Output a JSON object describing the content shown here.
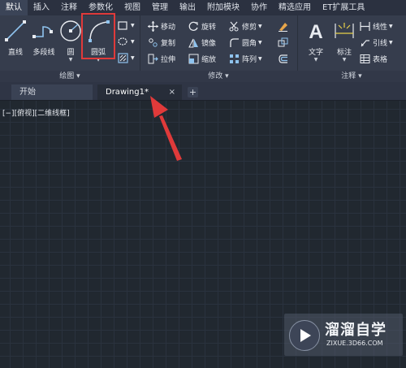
{
  "ribbon_tabs": [
    "默认",
    "插入",
    "注释",
    "参数化",
    "视图",
    "管理",
    "输出",
    "附加模块",
    "协作",
    "精选应用",
    "ET扩展工具"
  ],
  "draw_panel": {
    "title": "绘图",
    "line": "直线",
    "polyline": "多段线",
    "circle": "圆",
    "arc": "圆弧"
  },
  "modify_panel": {
    "title": "修改",
    "move": "移动",
    "rotate": "旋转",
    "trim": "修剪",
    "copy": "复制",
    "mirror": "镜像",
    "fillet": "圆角",
    "stretch": "拉伸",
    "scale": "缩放",
    "array": "阵列"
  },
  "annotation_panel": {
    "title": "注释",
    "text": "文字",
    "dimension": "标注",
    "linear": "线性",
    "leader": "引线",
    "table": "表格"
  },
  "doc_tabs": {
    "start": "开始",
    "drawing": "Drawing1*",
    "close": "×",
    "new": "+"
  },
  "viewport_label": "[−][俯视][二维线框]",
  "watermark": {
    "title": "溜溜自学",
    "url": "ZIXUE.3D66.COM"
  },
  "colors": {
    "highlight": "#e03a3a",
    "canvas": "#212830",
    "ribbon": "#363d4d"
  }
}
